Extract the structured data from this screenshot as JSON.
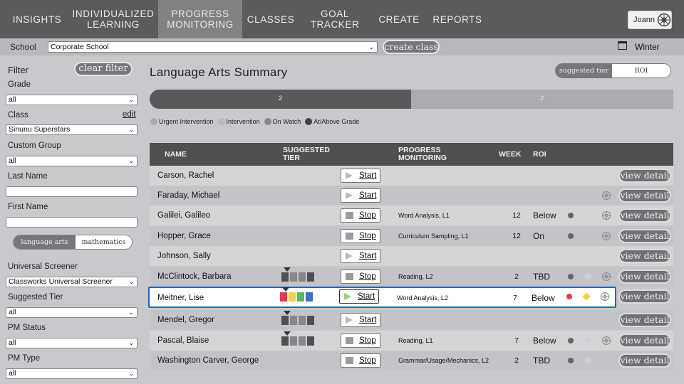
{
  "nav": {
    "items": [
      {
        "label": "INSIGHTS",
        "active": false
      },
      {
        "label": "INDIVIDUALIZED\nLEARNING",
        "active": false
      },
      {
        "label": "PROGRESS\nMONITORING",
        "active": true
      },
      {
        "label": "CLASSES",
        "active": false
      },
      {
        "label": "GOAL TRACKER",
        "active": false
      },
      {
        "label": "CREATE",
        "active": false
      },
      {
        "label": "REPORTS",
        "active": false
      }
    ],
    "user_name": "Joann"
  },
  "school_bar": {
    "label": "School",
    "school_value": "Corporate School",
    "create_class_label": "create class",
    "season": "Winter"
  },
  "sidebar": {
    "filter_label": "Filter",
    "clear_filter_label": "clear filter",
    "grade_label": "Grade",
    "grade_value": "all",
    "class_label": "Class",
    "class_edit_label": "edit",
    "class_value": "Sinunu Superstars",
    "custom_group_label": "Custom Group",
    "custom_group_value": "all",
    "last_name_label": "Last Name",
    "first_name_label": "First Name",
    "subject_la": "language arts",
    "subject_math": "mathematics",
    "universal_screener_label": "Universal Screener",
    "universal_screener_value": "Classworks Universal Screener",
    "suggested_tier_label": "Suggested Tier",
    "suggested_tier_value": "all",
    "pm_status_label": "PM Status",
    "pm_status_value": "all",
    "pm_type_label": "PM Type",
    "pm_type_value": "all"
  },
  "main": {
    "title": "Language Arts Summary",
    "view_toggle": {
      "tier": "suggested tier",
      "roi": "ROI"
    },
    "progress": {
      "left_count": "2",
      "right_count": "2",
      "fill_fraction": 0.5
    }
  },
  "legend": [
    {
      "label": "Urgent Intervention",
      "color": "#a9abae"
    },
    {
      "label": "Intervention",
      "color": "#b9babc"
    },
    {
      "label": "On Watch",
      "color": "#86878a"
    },
    {
      "label": "At/Above Grade",
      "color": "#3f4042"
    }
  ],
  "table": {
    "headers": {
      "name": "NAME",
      "suggested_tier": "SUGGESTED\nTIER",
      "pm": "PROGRESS\nMONITORING",
      "week": "WEEK",
      "roi": "ROI"
    },
    "view_detail_label": "view detail",
    "rows": [
      {
        "name": "Carson, Rachel",
        "action": "Start",
        "monitoring": "",
        "week": "",
        "roi": "",
        "tier": false,
        "dot": "",
        "diamond": "",
        "gear": false
      },
      {
        "name": "Faraday, Michael",
        "action": "Start",
        "monitoring": "",
        "week": "",
        "roi": "",
        "tier": false,
        "dot": "",
        "diamond": "",
        "gear": true
      },
      {
        "name": "Galilei, Galileo",
        "action": "Stop",
        "monitoring": "Word Analysis, L1",
        "week": "12",
        "roi": "Below",
        "tier": false,
        "dot": "gray",
        "diamond": "",
        "gear": true
      },
      {
        "name": "Hopper, Grace",
        "action": "Stop",
        "monitoring": "Curriculum Sampling, L1",
        "week": "12",
        "roi": "On",
        "tier": false,
        "dot": "gray",
        "diamond": "",
        "gear": true
      },
      {
        "name": "Johnson, Sally",
        "action": "Start",
        "monitoring": "",
        "week": "",
        "roi": "",
        "tier": false,
        "dot": "",
        "diamond": "",
        "gear": false
      },
      {
        "name": "McClintock, Barbara",
        "action": "Stop",
        "monitoring": "Reading, L2",
        "week": "2",
        "roi": "TBD",
        "tier": true,
        "dot": "gray",
        "diamond": "light",
        "gear": true
      },
      {
        "name": "Meitner, Lise",
        "action": "Start",
        "monitoring": "Word Analysis, L2",
        "week": "7",
        "roi": "Below",
        "tier": true,
        "tier_colors": [
          "#e9394b",
          "#f5cf4b",
          "#5cb85c",
          "#3e6fd1"
        ],
        "dot": "red",
        "diamond": "gold",
        "gear": true,
        "selected": true
      },
      {
        "name": "Mendel, Gregor",
        "action": "Start",
        "monitoring": "",
        "week": "",
        "roi": "",
        "tier": true,
        "dot": "",
        "diamond": "",
        "gear": false
      },
      {
        "name": "Pascal, Blaise",
        "action": "Stop",
        "monitoring": "Reading, L1",
        "week": "7",
        "roi": "Below",
        "tier": true,
        "dot": "gray",
        "diamond": "light",
        "gear": true
      },
      {
        "name": "Washington Carver, George",
        "action": "Stop",
        "monitoring": "Grammar/Usage/Mechanics, L2",
        "week": "2",
        "roi": "TBD",
        "tier": false,
        "dot": "gray",
        "diamond": "light",
        "gear": false
      }
    ]
  }
}
